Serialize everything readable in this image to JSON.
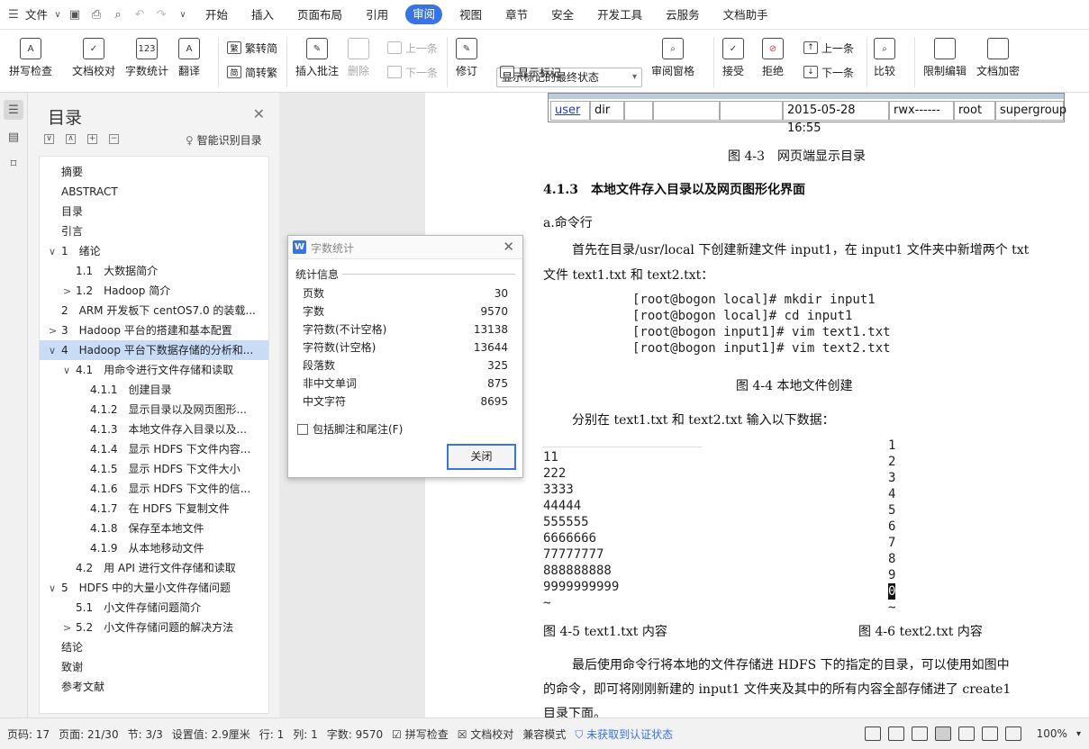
{
  "menubar": {
    "file_label": "文件",
    "items": [
      "开始",
      "插入",
      "页面布局",
      "引用",
      "审阅",
      "视图",
      "章节",
      "安全",
      "开发工具",
      "云服务",
      "文档助手"
    ],
    "active_index": 4
  },
  "ribbon": {
    "spell_check": "拼写检查",
    "doc_proof": "文档校对",
    "word_count": "字数统计",
    "translate": "翻译",
    "trad_to_simp": "繁转简",
    "simp_to_trad": "简转繁",
    "insert_comment": "插入批注",
    "delete": "删除",
    "prev_comment": "上一条",
    "next_comment": "下一条",
    "revise": "修订",
    "markup_mode": "显示标记的最终状态",
    "show_markup": "显示标记",
    "review_pane": "审阅窗格",
    "accept": "接受",
    "reject": "拒绝",
    "prev_change": "上一条",
    "next_change": "下一条",
    "compare": "比较",
    "restrict_edit": "限制编辑",
    "doc_encrypt": "文档加密"
  },
  "toc": {
    "title": "目录",
    "smart_toc": "智能识别目录",
    "items": [
      {
        "level": 0,
        "arrow": "",
        "text": "摘要"
      },
      {
        "level": 0,
        "arrow": "",
        "text": "ABSTRACT"
      },
      {
        "level": 0,
        "arrow": "",
        "text": "目录"
      },
      {
        "level": 0,
        "arrow": "",
        "text": "引言"
      },
      {
        "level": 0,
        "arrow": "∨",
        "text": "1　绪论"
      },
      {
        "level": 1,
        "arrow": "",
        "text": "1.1　大数据简介"
      },
      {
        "level": 1,
        "arrow": ">",
        "text": "1.2　Hadoop 简介"
      },
      {
        "level": 0,
        "arrow": "",
        "text": "2　ARM 开发板下 centOS7.0 的装载..."
      },
      {
        "level": 0,
        "arrow": ">",
        "text": "3　Hadoop 平台的搭建和基本配置"
      },
      {
        "level": 0,
        "arrow": "∨",
        "text": "4　Hadoop 平台下数据存储的分析和..."
      },
      {
        "level": 1,
        "arrow": "∨",
        "text": "4.1　用命令进行文件存储和读取"
      },
      {
        "level": 2,
        "arrow": "",
        "text": "4.1.1　创建目录"
      },
      {
        "level": 2,
        "arrow": "",
        "text": "4.1.2　显示目录以及网页图形..."
      },
      {
        "level": 2,
        "arrow": "",
        "text": "4.1.3　本地文件存入目录以及..."
      },
      {
        "level": 2,
        "arrow": "",
        "text": "4.1.4　显示 HDFS 下文件内容..."
      },
      {
        "level": 2,
        "arrow": "",
        "text": "4.1.5　显示 HDFS 下文件大小"
      },
      {
        "level": 2,
        "arrow": "",
        "text": "4.1.6　显示 HDFS 下文件的信..."
      },
      {
        "level": 2,
        "arrow": "",
        "text": "4.1.7　在 HDFS 下复制文件"
      },
      {
        "level": 2,
        "arrow": "",
        "text": "4.1.8　保存至本地文件"
      },
      {
        "level": 2,
        "arrow": "",
        "text": "4.1.9　从本地移动文件"
      },
      {
        "level": 1,
        "arrow": "",
        "text": "4.2　用 API 进行文件存储和读取"
      },
      {
        "level": 0,
        "arrow": "∨",
        "text": "5　HDFS 中的大量小文件存储问题"
      },
      {
        "level": 1,
        "arrow": "",
        "text": "5.1　小文件存储问题简介"
      },
      {
        "level": 1,
        "arrow": ">",
        "text": "5.2　小文件存储问题的解决方法"
      },
      {
        "level": 0,
        "arrow": "",
        "text": "结论"
      },
      {
        "level": 0,
        "arrow": "",
        "text": "致谢"
      },
      {
        "level": 0,
        "arrow": "",
        "text": "参考文献"
      }
    ],
    "selected_index": 9
  },
  "doc": {
    "table_row": {
      "name": "user",
      "type": "dir",
      "date": "2015-05-28　16:55",
      "perm": "rwx------",
      "owner": "root",
      "group": "supergroup"
    },
    "fig43": "图 4-3　网页端显示目录",
    "heading": "4.1.3　本地文件存入目录以及网页图形化界面",
    "sub_a": "a.命令行",
    "para1_line1": "首先在目录/usr/local 下创建新建文件 input1，在 input1 文件夹中新增两个 txt",
    "para1_line2": "文件 text1.txt 和 text2.txt：",
    "cmds": [
      "[root@bogon local]# mkdir input1",
      "[root@bogon local]# cd input1",
      "[root@bogon input1]# vim text1.txt",
      "[root@bogon input1]# vim text2.txt"
    ],
    "fig44": "图 4-4  本地文件创建",
    "para2": "分别在 text1.txt 和 text2.txt 输入以下数据：",
    "text1_lines": [
      "11",
      "222",
      "3333",
      "44444",
      "555555",
      "6666666",
      "77777777",
      "888888888",
      "9999999999",
      "~"
    ],
    "text2_lines": [
      "1",
      "2",
      "3",
      "4",
      "5",
      "6",
      "7",
      "8",
      "9",
      "0",
      "~"
    ],
    "fig45": "图 4-5 text1.txt 内容",
    "fig46": "图 4-6 text2.txt 内容",
    "para3_line1": "最后使用命令行将本地的文件存储进 HDFS 下的指定的目录，可以使用如图中",
    "para3_line2": "的命令，即可将刚刚新建的 input1 文件夹及其中的所有内容全部存储进了 create1",
    "para3_line3": "目录下面。"
  },
  "dialog": {
    "title": "字数统计",
    "section": "统计信息",
    "rows": [
      {
        "label": "页数",
        "value": "30"
      },
      {
        "label": "字数",
        "value": "9570"
      },
      {
        "label": "字符数(不计空格)",
        "value": "13138"
      },
      {
        "label": "字符数(计空格)",
        "value": "13644"
      },
      {
        "label": "段落数",
        "value": "325"
      },
      {
        "label": "非中文单词",
        "value": "875"
      },
      {
        "label": "中文字符",
        "value": "8695"
      }
    ],
    "checkbox_label": "包括脚注和尾注(F)",
    "close_button": "关闭"
  },
  "status": {
    "page_code": "页码: 17",
    "page": "页面: 21/30",
    "section": "节: 3/3",
    "setting": "设置值: 2.9厘米",
    "row": "行: 1",
    "col": "列: 1",
    "words": "字数: 9570",
    "spell": "拼写检查",
    "proof": "文档校对",
    "compat": "兼容模式",
    "cert": "未获取到认证状态",
    "zoom": "100%"
  }
}
